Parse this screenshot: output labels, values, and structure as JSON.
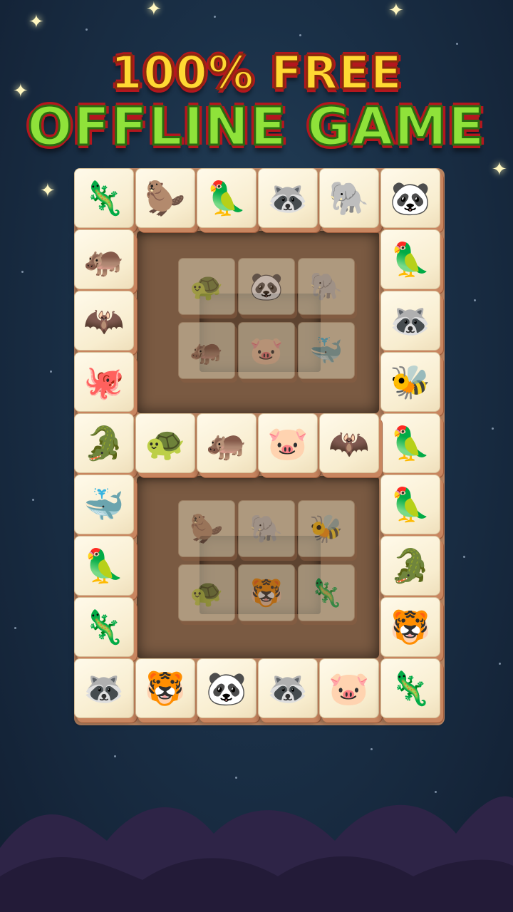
{
  "title": {
    "line1": "100% FREE",
    "line2": "OFFLINE GAME"
  },
  "colors": {
    "sky": "#1a3047",
    "title_yellow": "#ffd933",
    "title_green": "#8fe23a",
    "title_outline": "#b3171e",
    "tile_face": "#f8edcf",
    "tile_side": "#c8855f"
  },
  "board": {
    "top_tiles": [
      {
        "animal": "chameleon",
        "glyph": "🦎"
      },
      {
        "animal": "beaver",
        "glyph": "🦫"
      },
      {
        "animal": "cockatoo",
        "glyph": "🦜"
      },
      {
        "animal": "raccoon",
        "glyph": "🦝"
      },
      {
        "animal": "elephant",
        "glyph": "🐘"
      },
      {
        "animal": "panda",
        "glyph": "🐼"
      }
    ],
    "left_tiles": [
      {
        "animal": "hippo",
        "glyph": "🦛"
      },
      {
        "animal": "bat",
        "glyph": "🦇"
      },
      {
        "animal": "octopus",
        "glyph": "🐙"
      },
      {
        "animal": "crocodile",
        "glyph": "🐊"
      },
      {
        "animal": "whale",
        "glyph": "🐳"
      },
      {
        "animal": "parrot",
        "glyph": "🦜"
      },
      {
        "animal": "chameleon",
        "glyph": "🦎"
      }
    ],
    "right_tiles": [
      {
        "animal": "parrot",
        "glyph": "🦜"
      },
      {
        "animal": "raccoon",
        "glyph": "🦝"
      },
      {
        "animal": "bee",
        "glyph": "🐝"
      },
      {
        "animal": "parrot",
        "glyph": "🦜"
      },
      {
        "animal": "cockatoo",
        "glyph": "🦜"
      },
      {
        "animal": "crocodile",
        "glyph": "🐊"
      },
      {
        "animal": "tiger",
        "glyph": "🐯"
      }
    ],
    "middle_tiles": [
      {
        "animal": "turtle",
        "glyph": "🐢"
      },
      {
        "animal": "hippo",
        "glyph": "🦛"
      },
      {
        "animal": "pig",
        "glyph": "🐷"
      },
      {
        "animal": "bat",
        "glyph": "🦇"
      }
    ],
    "bottom_tiles": [
      {
        "animal": "raccoon",
        "glyph": "🦝"
      },
      {
        "animal": "tiger",
        "glyph": "🐯"
      },
      {
        "animal": "panda",
        "glyph": "🐼"
      },
      {
        "animal": "raccoon",
        "glyph": "🦝"
      },
      {
        "animal": "pig",
        "glyph": "🐷"
      },
      {
        "animal": "chameleon",
        "glyph": "🦎"
      }
    ],
    "deep_tiles_upper": [
      {
        "animal": "turtle",
        "glyph": "🐢"
      },
      {
        "animal": "panda",
        "glyph": "🐼"
      },
      {
        "animal": "elephant",
        "glyph": "🐘"
      },
      {
        "animal": "hippo",
        "glyph": "🦛"
      },
      {
        "animal": "pig",
        "glyph": "🐷"
      },
      {
        "animal": "whale",
        "glyph": "🐳"
      }
    ],
    "deep_tiles_lower": [
      {
        "animal": "beaver",
        "glyph": "🦫"
      },
      {
        "animal": "elephant",
        "glyph": "🐘"
      },
      {
        "animal": "bee",
        "glyph": "🐝"
      },
      {
        "animal": "turtle",
        "glyph": "🐢"
      },
      {
        "animal": "tiger",
        "glyph": "🐯"
      },
      {
        "animal": "chameleon",
        "glyph": "🦎"
      }
    ]
  }
}
